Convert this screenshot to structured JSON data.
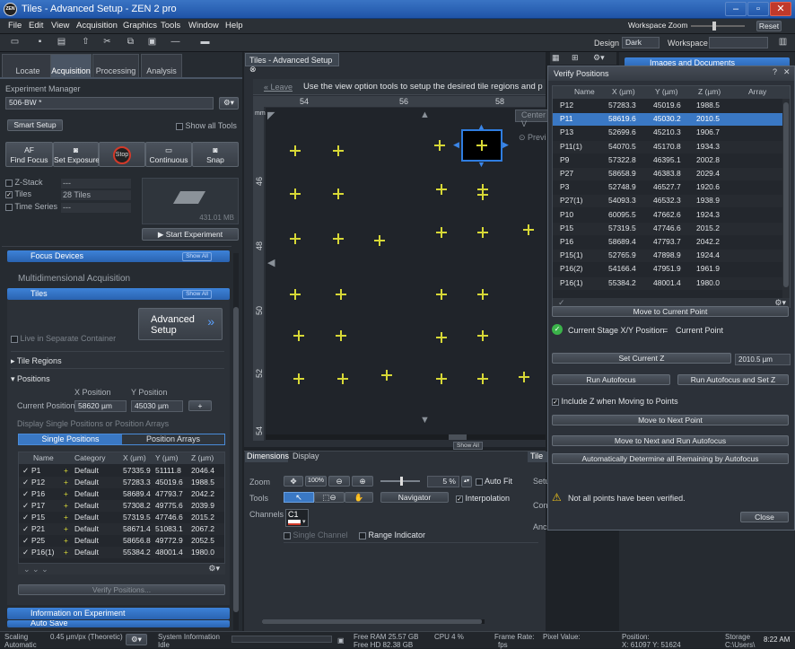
{
  "window": {
    "title": "Tiles - Advanced Setup - ZEN 2 pro",
    "logo": "ZEN",
    "workspace_zoom_label": "Workspace Zoom",
    "reset_label": "Reset"
  },
  "menu": [
    "File",
    "Edit",
    "View",
    "Acquisition",
    "Graphics",
    "Tools",
    "Window",
    "Help"
  ],
  "toolbar": {
    "design_label": "Design",
    "design_value": "Dark",
    "workspace_label": "Workspace"
  },
  "left": {
    "tabs": [
      "Locate",
      "Acquisition",
      "Processing",
      "Analysis"
    ],
    "experiment_manager_label": "Experiment Manager",
    "experiment_name": "506-BW *",
    "smart_setup": "Smart Setup",
    "show_all_tools": "Show all Tools",
    "actions": [
      "Find Focus",
      "Set Exposure",
      "Stop",
      "Continuous",
      "Snap"
    ],
    "af_label": "AF",
    "dims": [
      {
        "label": "Z-Stack",
        "value": "---",
        "checked": false
      },
      {
        "label": "Tiles",
        "value": "28 Tiles",
        "checked": true
      },
      {
        "label": "Time Series",
        "value": "---",
        "checked": false
      }
    ],
    "preview_size": "431.01 MB",
    "start_experiment": "Start Experiment",
    "focus_devices": "Focus Devices",
    "show_all": "Show All",
    "multidim_label": "Multidimensional Acquisition",
    "tiles_section": "Tiles",
    "advanced_setup": "Advanced Setup",
    "live_separate": "Live in Separate Container",
    "tile_regions": "Tile Regions",
    "positions": "Positions",
    "x_position_label": "X Position",
    "y_position_label": "Y Position",
    "current_position_label": "Current Position",
    "current_x": "58620 µm",
    "current_y": "45030 µm",
    "display_label": "Display Single Positions or Position Arrays",
    "single_positions": "Single Positions",
    "position_arrays": "Position Arrays",
    "table_headers": [
      "Name",
      "Category",
      "X (µm)",
      "Y (µm)",
      "Z (µm)"
    ],
    "table_rows": [
      [
        "P1",
        "Default",
        "57335.9",
        "51111.8",
        "2046.4"
      ],
      [
        "P12",
        "Default",
        "57283.3",
        "45019.6",
        "1988.5"
      ],
      [
        "P16",
        "Default",
        "58689.4",
        "47793.7",
        "2042.2"
      ],
      [
        "P17",
        "Default",
        "57308.2",
        "49775.6",
        "2039.9"
      ],
      [
        "P15",
        "Default",
        "57319.5",
        "47746.6",
        "2015.2"
      ],
      [
        "P21",
        "Default",
        "58671.4",
        "51083.1",
        "2067.2"
      ],
      [
        "P25",
        "Default",
        "58656.8",
        "49772.9",
        "2052.5"
      ],
      [
        "P16(1)",
        "Default",
        "55384.2",
        "48001.4",
        "1980.0"
      ]
    ],
    "verify_positions": "Verify Positions...",
    "info_experiment": "Information on Experiment",
    "auto_save": "Auto Save"
  },
  "center": {
    "doc_tab": "Tiles - Advanced Setup",
    "leave": "« Leave",
    "hint": "Use the view option tools to setup the desired tile regions and p",
    "center_label": "Center V",
    "preview_label": "Previ",
    "ruler_top": [
      "54",
      "56",
      "58"
    ],
    "ruler_left": [
      "46",
      "48",
      "50",
      "52",
      "54"
    ],
    "ruler_unit": "mm",
    "show_all": "Show All"
  },
  "dimensions": {
    "tabs": [
      "Dimensions",
      "Display"
    ],
    "zoom_label": "Zoom",
    "zoom_value": "5 %",
    "zoom_presets": [
      "100%"
    ],
    "auto_fit": "Auto Fit",
    "tools_label": "Tools",
    "navigator": "Navigator",
    "interpolation": "Interpolation",
    "channels_label": "Channels",
    "channel": "C1",
    "single_channel": "Single Channel",
    "range_indicator": "Range Indicator",
    "side_tab": "Tile",
    "side_labels": [
      "Setu",
      "Con",
      "Anc"
    ]
  },
  "rightpanel": {
    "images_docs": "Images and Documents"
  },
  "verify": {
    "title": "Verify Positions",
    "headers": [
      "Name",
      "X (µm)",
      "Y (µm)",
      "Z (µm)",
      "Array"
    ],
    "rows": [
      [
        "P12",
        "57283.3",
        "45019.6",
        "1988.5"
      ],
      [
        "P11",
        "58619.6",
        "45030.2",
        "2010.5"
      ],
      [
        "P13",
        "52699.6",
        "45210.3",
        "1906.7"
      ],
      [
        "P11(1)",
        "54070.5",
        "45170.8",
        "1934.3"
      ],
      [
        "P9",
        "57322.8",
        "46395.1",
        "2002.8"
      ],
      [
        "P27",
        "58658.9",
        "46383.8",
        "2029.4"
      ],
      [
        "P3",
        "52748.9",
        "46527.7",
        "1920.6"
      ],
      [
        "P27(1)",
        "54093.3",
        "46532.3",
        "1938.9"
      ],
      [
        "P10",
        "60095.5",
        "47662.6",
        "1924.3"
      ],
      [
        "P15",
        "57319.5",
        "47746.6",
        "2015.2"
      ],
      [
        "P16",
        "58689.4",
        "47793.7",
        "2042.2"
      ],
      [
        "P15(1)",
        "52765.9",
        "47898.9",
        "1924.4"
      ],
      [
        "P16(2)",
        "54166.4",
        "47951.9",
        "1961.9"
      ],
      [
        "P16(1)",
        "55384.2",
        "48001.4",
        "1980.0"
      ]
    ],
    "selected_row": 1,
    "move_current": "Move to Current Point",
    "current_stage": "Current Stage X/Y Position",
    "equals": "=",
    "current_point": "Current Point",
    "set_current_z": "Set Current Z",
    "z_value": "2010.5 µm",
    "run_autofocus": "Run Autofocus",
    "run_autofocus_set_z": "Run Autofocus and Set Z",
    "include_z": "Include Z when Moving to Points",
    "move_next": "Move to Next Point",
    "move_next_af": "Move to Next and Run Autofocus",
    "auto_determine": "Automatically Determine all Remaining by Autofocus",
    "warning": "Not all points have been verified.",
    "close": "Close",
    "close_x": "✕",
    "help": "?"
  },
  "status": {
    "scaling_label": "Scaling",
    "scaling_value": "0.45 µm/px (Theoretic)",
    "scaling_mode": "Automatic",
    "system_info": "System Information",
    "system_state": "Idle",
    "free_ram": "Free RAM 25.57 GB",
    "free_hd": "Free HD   82.38 GB",
    "cpu": "CPU 4 %",
    "frame_rate_label": "Frame Rate:",
    "frame_rate_unit": "fps",
    "pixel_value": "Pixel Value:",
    "position_label": "Position:",
    "position_value": "X: 61097  Y: 51624",
    "storage_label": "Storage",
    "storage_value": "C:\\Users\\",
    "time": "8:22 AM"
  }
}
